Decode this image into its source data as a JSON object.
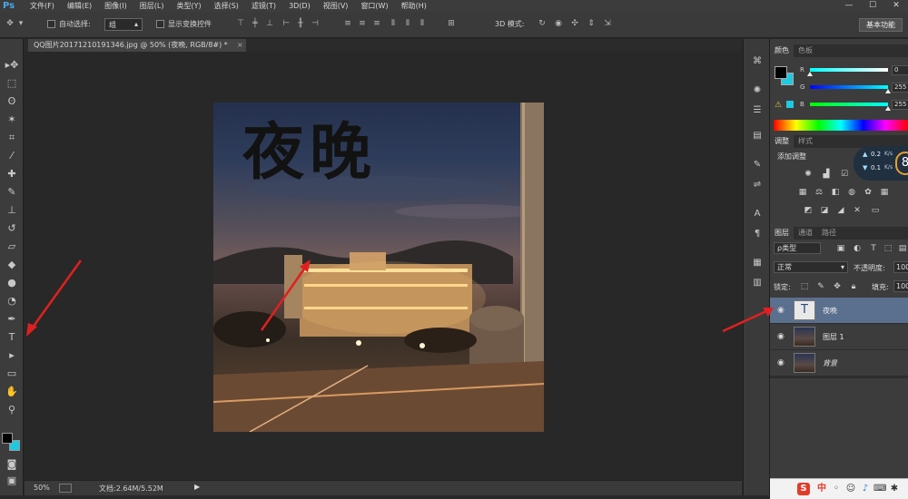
{
  "app": {
    "logo": "Ps"
  },
  "menu": [
    "文件(F)",
    "编辑(E)",
    "图像(I)",
    "图层(L)",
    "类型(Y)",
    "选择(S)",
    "滤镜(T)",
    "3D(D)",
    "视图(V)",
    "窗口(W)",
    "帮助(H)"
  ],
  "window_controls": {
    "minimize": "—",
    "maximize": "☐",
    "close": "✕"
  },
  "options_bar": {
    "auto_select_label": "自动选择:",
    "auto_select_value": "组",
    "show_transform_label": "显示变换控件",
    "mode_3d_label": "3D 模式:",
    "workspace": "基本功能"
  },
  "document": {
    "tab_title": "QQ图片20171210191346.jpg @ 50% (夜晚, RGB/8#) *",
    "tab_close": "×",
    "image_text": "夜晚",
    "zoom": "50%",
    "doc_size": "文档:2.64M/5.52M"
  },
  "color_panel": {
    "tabs": [
      "颜色",
      "色板"
    ],
    "channels": [
      {
        "label": "R",
        "value": "0"
      },
      {
        "label": "G",
        "value": "255"
      },
      {
        "label": "B",
        "value": "255"
      }
    ],
    "foreground": "#000000",
    "background": "#20c8e0"
  },
  "adjust_panel": {
    "tabs": [
      "调整",
      "样式"
    ],
    "title": "添加调整",
    "net_up": "0.2",
    "net_down": "0.1",
    "net_unit": "K/s",
    "net_circle": "8"
  },
  "layers_panel": {
    "tabs": [
      "图层",
      "通道",
      "路径"
    ],
    "filter_kind": "ρ类型",
    "blend_mode": "正常",
    "opacity_label": "不透明度:",
    "opacity_value": "100",
    "lock_label": "锁定:",
    "fill_label": "填充:",
    "fill_value": "100",
    "layers": [
      {
        "name": "夜晚",
        "thumb": "T",
        "visible": true,
        "selected": true
      },
      {
        "name": "图层 1",
        "thumb": "",
        "visible": true,
        "selected": false
      },
      {
        "name": "背景",
        "thumb": "",
        "visible": true,
        "selected": false
      }
    ]
  },
  "system_tray": {
    "ime": "中",
    "brand_color": "#e23b2a"
  },
  "colors": {
    "accent": "#4aa8e8",
    "arrow": "#e02020",
    "selected_layer": "#5b6f8f"
  }
}
